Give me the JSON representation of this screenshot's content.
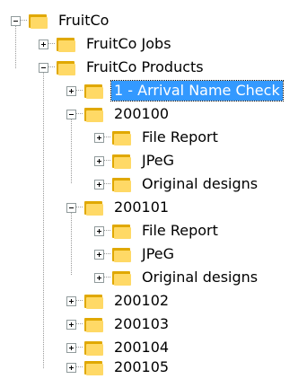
{
  "tree": {
    "root": {
      "label": "FruitCo",
      "expanded": true,
      "children": [
        {
          "label": "FruitCo Jobs",
          "expanded": false
        },
        {
          "label": "FruitCo Products",
          "expanded": true,
          "children": [
            {
              "label": "1 - Arrival Name Check",
              "expanded": false,
              "selected": true
            },
            {
              "label": "200100",
              "expanded": true,
              "children": [
                {
                  "label": "File Report",
                  "expanded": false
                },
                {
                  "label": "JPeG",
                  "expanded": false
                },
                {
                  "label": "Original designs",
                  "expanded": false
                }
              ]
            },
            {
              "label": "200101",
              "expanded": true,
              "children": [
                {
                  "label": "File Report",
                  "expanded": false
                },
                {
                  "label": "JPeG",
                  "expanded": false
                },
                {
                  "label": "Original designs",
                  "expanded": false
                }
              ]
            },
            {
              "label": "200102",
              "expanded": false
            },
            {
              "label": "200103",
              "expanded": false
            },
            {
              "label": "200104",
              "expanded": false
            },
            {
              "label": "200105",
              "expanded": false
            }
          ]
        }
      ]
    }
  },
  "colors": {
    "selection_bg": "#3399ff",
    "selection_text": "#ffffff",
    "folder_light": "#ffd966",
    "folder_dark": "#e0a800"
  },
  "icons": {
    "folder": "folder-icon",
    "expand": "plus-box-icon",
    "collapse": "minus-box-icon"
  }
}
